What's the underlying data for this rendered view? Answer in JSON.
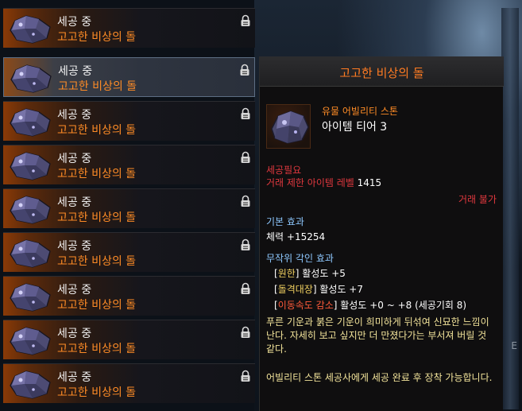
{
  "list": {
    "items": [
      {
        "status": "세공 중",
        "name": "고고한 비상의 돌",
        "selected": false
      },
      {
        "status": "세공 중",
        "name": "고고한 비상의 돌",
        "selected": true
      },
      {
        "status": "세공 중",
        "name": "고고한 비상의 돌",
        "selected": false
      },
      {
        "status": "세공 중",
        "name": "고고한 비상의 돌",
        "selected": false
      },
      {
        "status": "세공 중",
        "name": "고고한 비상의 돌",
        "selected": false
      },
      {
        "status": "세공 중",
        "name": "고고한 비상의 돌",
        "selected": false
      },
      {
        "status": "세공 중",
        "name": "고고한 비상의 돌",
        "selected": false
      },
      {
        "status": "세공 중",
        "name": "고고한 비상의 돌",
        "selected": false
      },
      {
        "status": "세공 중",
        "name": "고고한 비상의 돌",
        "selected": false
      }
    ],
    "lock_icon": "lock-icon",
    "item_icon": "gem-stone-icon"
  },
  "tooltip": {
    "title": "고고한 비상의 돌",
    "kind": "유물 어빌리티 스톤",
    "tier": "아이템 티어 3",
    "craft_required": "세공필요",
    "trade_level_label": "거래 제한 아이템 레벨",
    "trade_level_value": "1415",
    "trade_status": "거래 불가",
    "base_effect_label": "기본 효과",
    "base_effect_value": "체력 +15254",
    "random_engrave_label": "무작위 각인 효과",
    "engravings": [
      {
        "open": "[",
        "name": "원한",
        "close": "]",
        "value": "활성도 +5",
        "color": "#f0d060"
      },
      {
        "open": "[",
        "name": "돌격대장",
        "close": "]",
        "value": "활성도 +7",
        "color": "#f0d060"
      },
      {
        "open": "[",
        "name": "이동속도 감소",
        "close": "]",
        "value": "활성도 +0 ~ +8 (세공기회 8)",
        "color": "#ff5a3a"
      }
    ],
    "flavor": "푸른 기운과 붉은 기운이 희미하게 뒤섞여 신묘한 느낌이 난다. 자세히 보고 싶지만 더 만졌다가는 부서져 버릴 것 같다.",
    "equip_note": "어빌리티 스톤 세공사에게 세공 완료 후 장착 가능합니다."
  },
  "background": {
    "partial_text": "E"
  },
  "colors": {
    "accent_orange": "#ff8c26",
    "warning_red": "#e0383e",
    "section_blue": "#8ec8ff",
    "flavor_yellow": "#f2e39a"
  }
}
